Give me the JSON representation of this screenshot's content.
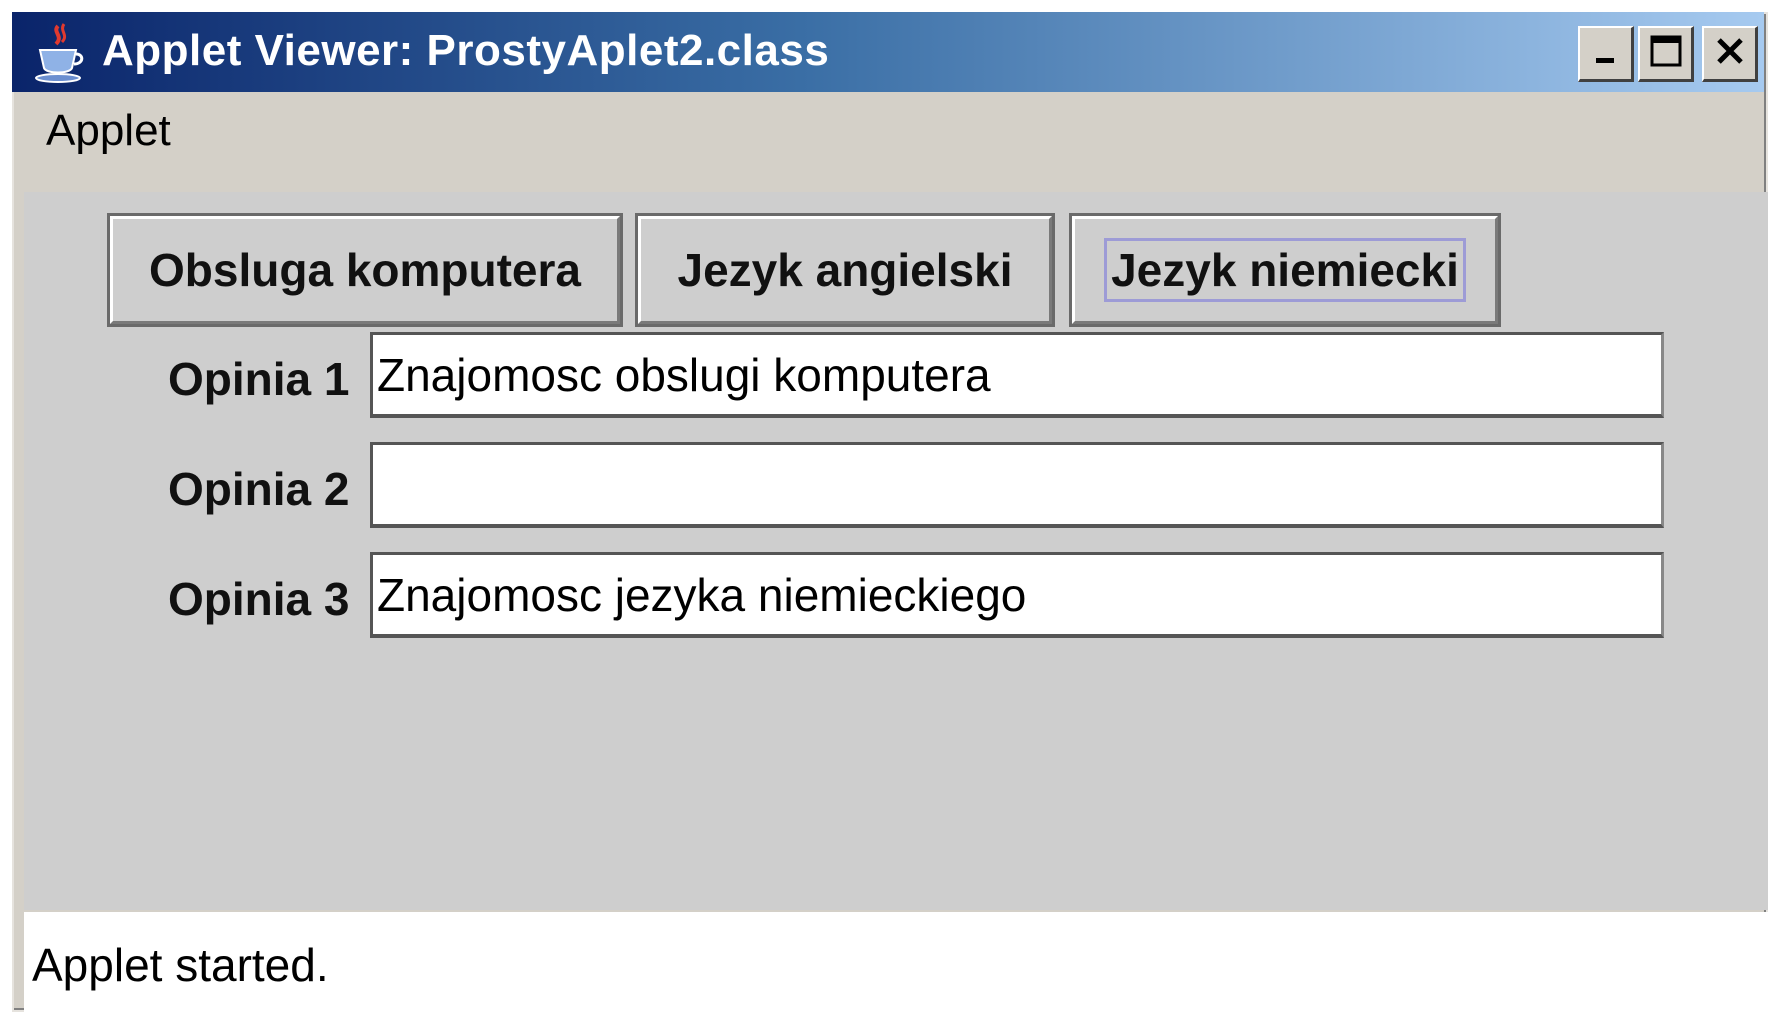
{
  "window": {
    "title": "Applet Viewer: ProstyAplet2.class",
    "icon": "java-cup-icon",
    "controls": {
      "minimize_icon": "minimize-icon",
      "maximize_icon": "maximize-icon",
      "close_icon": "close-icon"
    }
  },
  "menubar": {
    "items": [
      {
        "label": "Applet"
      }
    ]
  },
  "buttons": [
    {
      "label": "Obsluga komputera"
    },
    {
      "label": "Jezyk angielski"
    },
    {
      "label": "Jezyk niemiecki",
      "focused": true
    }
  ],
  "opinions": [
    {
      "label": "Opinia 1",
      "value": "Znajomosc obslugi komputera"
    },
    {
      "label": "Opinia 2",
      "value": ""
    },
    {
      "label": "Opinia 3",
      "value": "Znajomosc jezyka niemieckiego"
    }
  ],
  "status": {
    "text": "Applet started."
  },
  "colors": {
    "titlebar_start": "#0a246a",
    "titlebar_end": "#a6caf0",
    "panel_background": "#cecece",
    "window_frame": "#d4d0c8",
    "focus_ring": "#9d9bd6"
  }
}
